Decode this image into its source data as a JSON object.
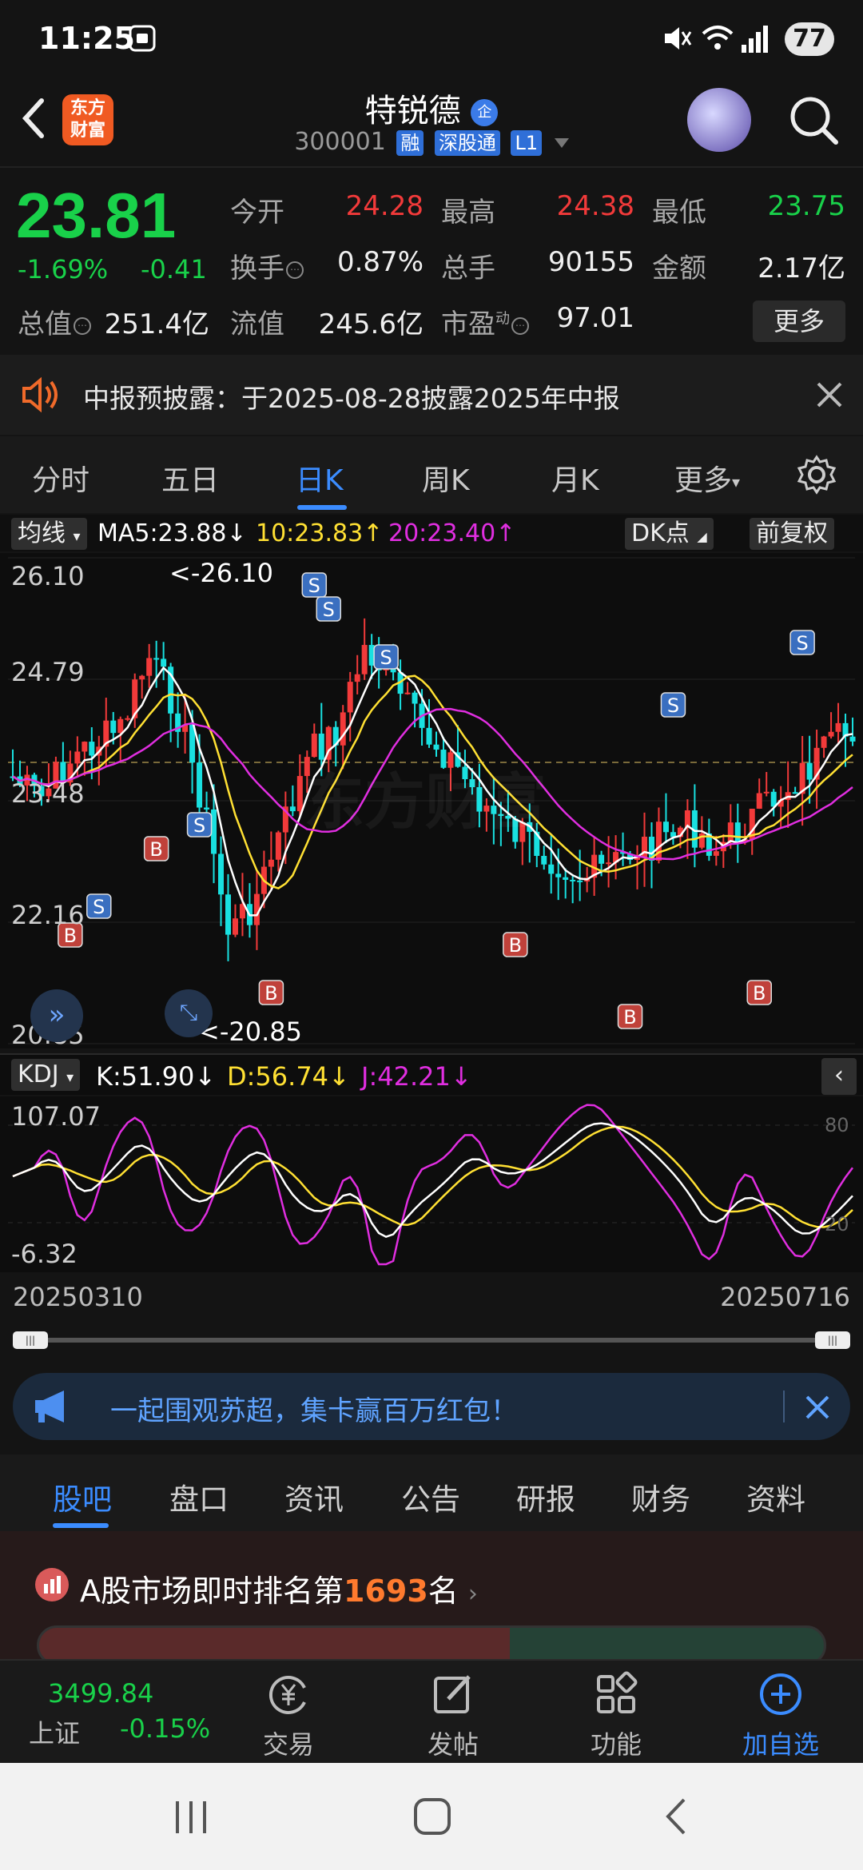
{
  "status": {
    "time": "11:25",
    "battery": "77"
  },
  "header": {
    "logo_line1": "东方",
    "logo_line2": "财富",
    "title": "特锐德",
    "title_badge": "企",
    "code": "300001",
    "tags": [
      "融",
      "深股通",
      "L1"
    ]
  },
  "quote": {
    "price": "23.81",
    "pct": "-1.69%",
    "change": "-0.41",
    "open_label": "今开",
    "open": "24.28",
    "high_label": "最高",
    "high": "24.38",
    "low_label": "最低",
    "low": "23.75",
    "turnover_label": "换手",
    "turnover": "0.87%",
    "volume_label": "总手",
    "volume": "90155",
    "amount_label": "金额",
    "amount": "2.17亿",
    "mktcap_label": "总值",
    "mktcap": "251.4亿",
    "float_label": "流值",
    "float": "245.6亿",
    "pe_label": "市盈",
    "pe_sup": "动",
    "pe": "97.01",
    "more": "更多"
  },
  "notice": {
    "text": "中报预披露：于2025-08-28披露2025年中报"
  },
  "period_tabs": [
    "分时",
    "五日",
    "日K",
    "周K",
    "月K",
    "更多"
  ],
  "ma": {
    "selector": "均线",
    "ma5": "MA5:23.88",
    "ma10": "10:23.83",
    "ma20": "20:23.40",
    "dk": "DK点",
    "adjust": "前复权"
  },
  "kline": {
    "ymax": "26.10",
    "y2": "24.79",
    "y3": "23.48",
    "y4": "22.16",
    "ymin": "20.85",
    "high_mark": "<-26.10",
    "low_mark": "<-20.85",
    "watermark": "东方财富"
  },
  "kdj": {
    "selector": "KDJ",
    "k": "K:51.90",
    "d": "D:56.74",
    "j": "J:42.21",
    "ymax": "107.07",
    "ymin": "-6.32",
    "l80": "80",
    "l20": "20"
  },
  "dates": {
    "start": "20250310",
    "end": "20250716"
  },
  "banner": {
    "text": "一起围观苏超，集卡赢百万红包！"
  },
  "lower_tabs": [
    "股吧",
    "盘口",
    "资讯",
    "公告",
    "研报",
    "财务",
    "资料"
  ],
  "rank": {
    "prefix": "A股市场即时排名第",
    "num": "1693",
    "suffix": "名"
  },
  "bottom": {
    "index_value": "3499.84",
    "index_name": "上证",
    "index_pct": "-0.15%",
    "items": [
      "交易",
      "发帖",
      "功能",
      "加自选"
    ]
  },
  "colors": {
    "up": "#f23a3a",
    "down": "#19d14a",
    "accent": "#3b8cff",
    "ma5": "#ffffff",
    "ma10": "#ffe033",
    "ma20": "#e02ee0"
  }
}
